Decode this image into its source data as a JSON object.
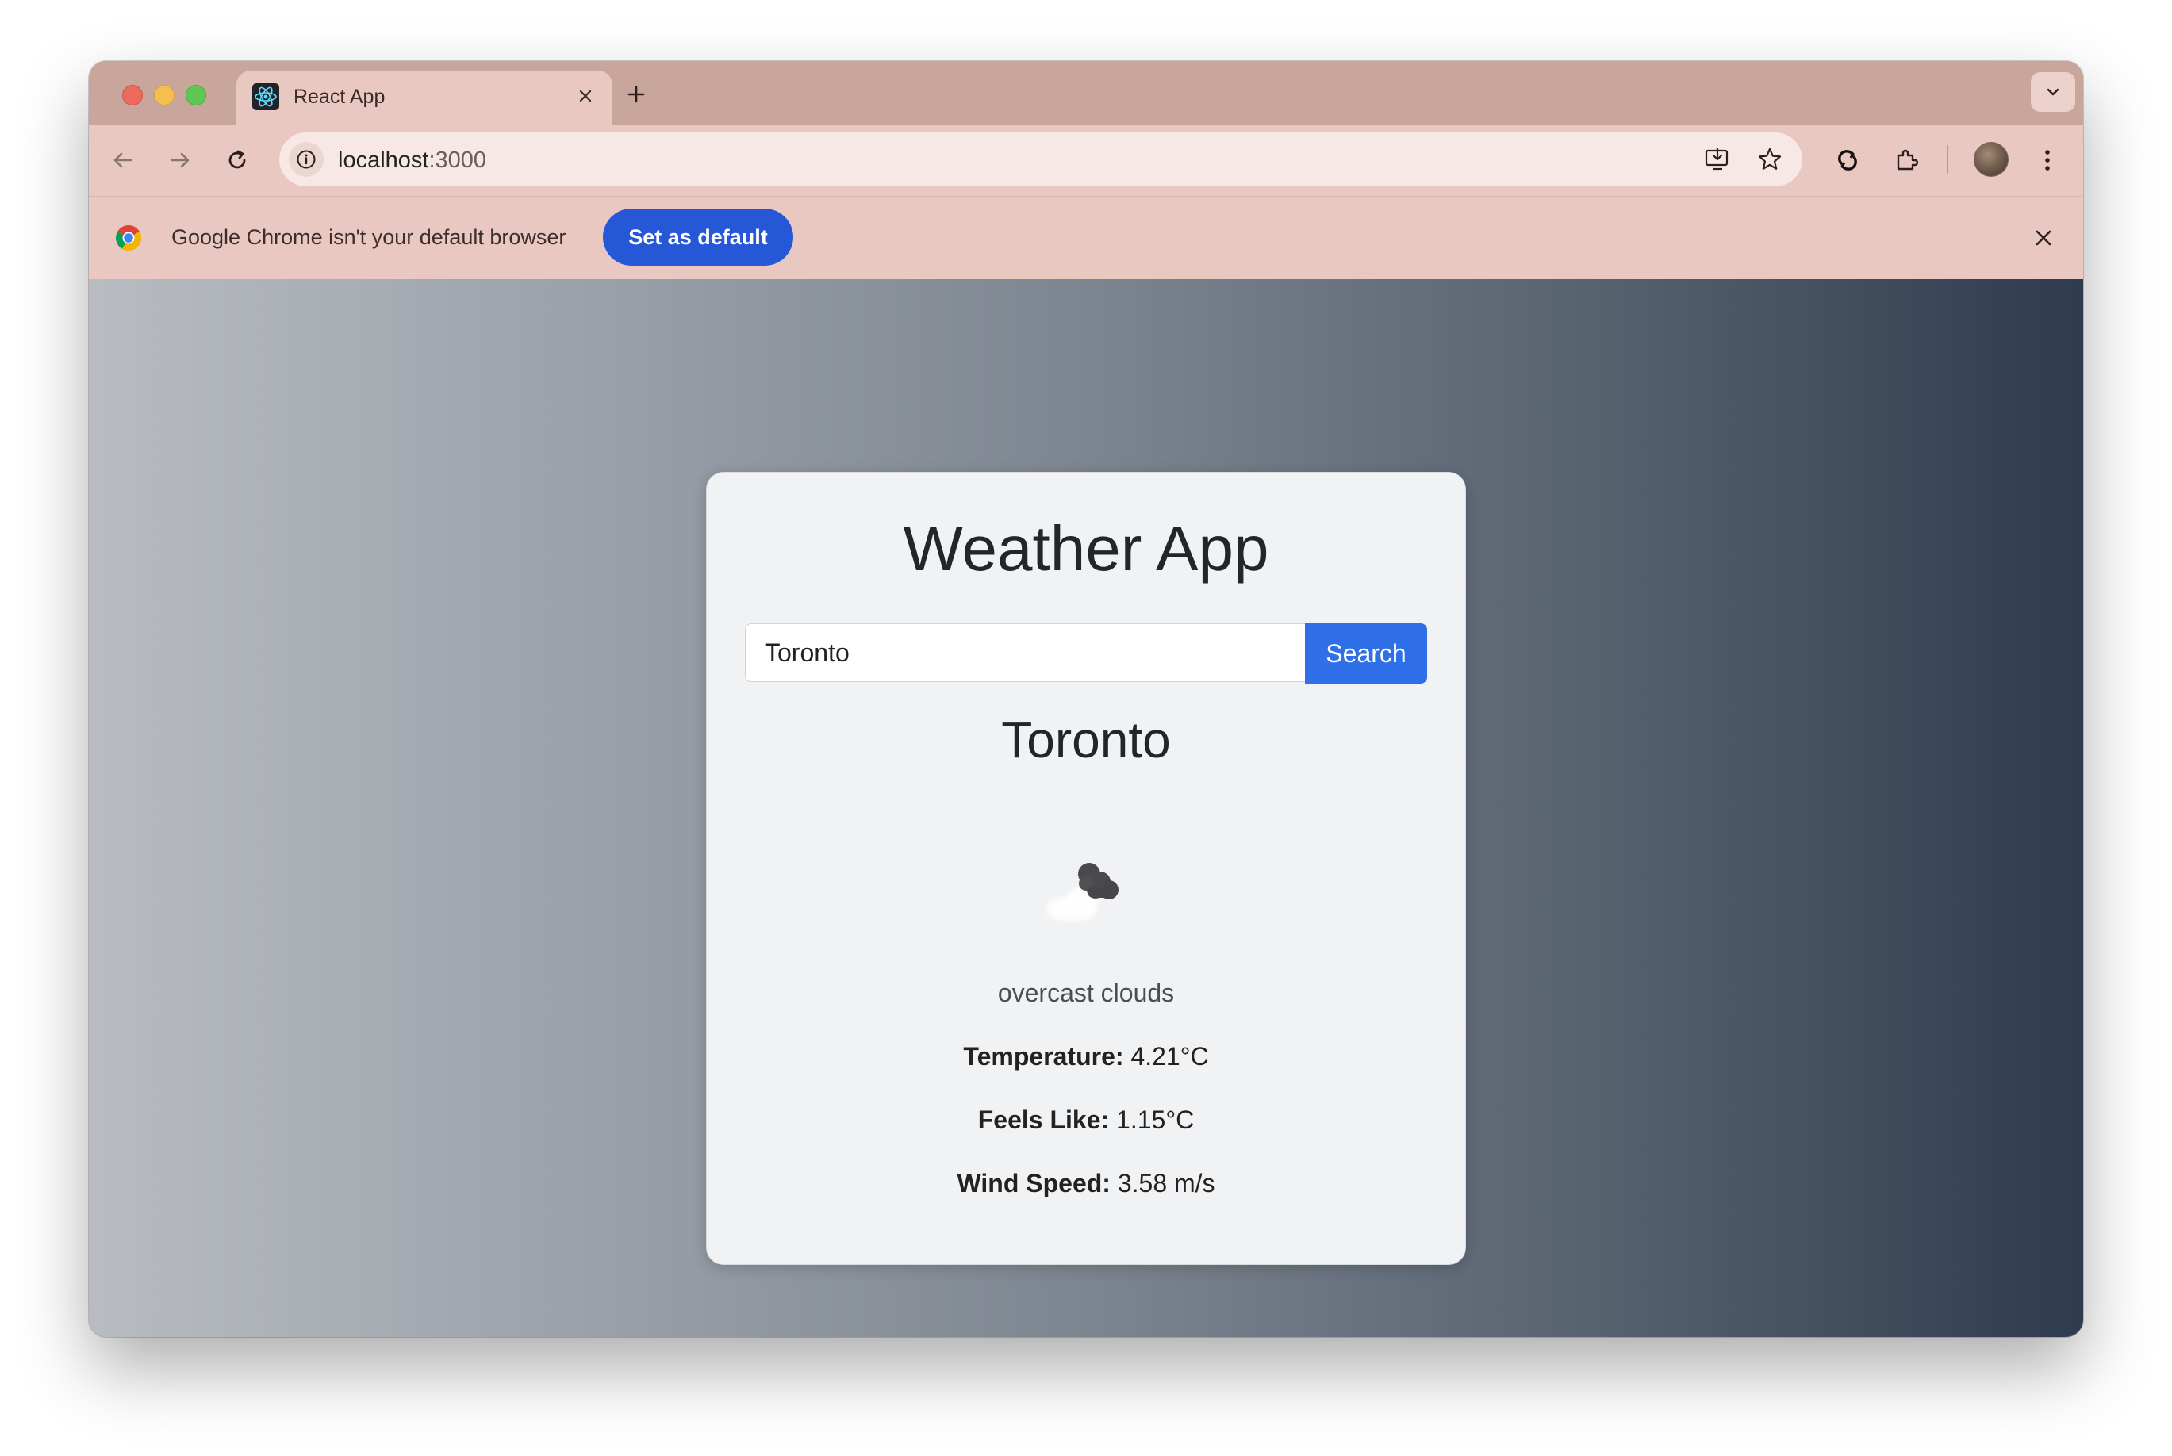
{
  "browser": {
    "tab": {
      "title": "React App",
      "icon": "react-logo-icon"
    },
    "address": {
      "host": "localhost",
      "port": ":3000"
    },
    "infobar": {
      "message": "Google Chrome isn't your default browser",
      "button_label": "Set as default"
    }
  },
  "app": {
    "title": "Weather App",
    "search": {
      "value": "Toronto",
      "button_label": "Search"
    },
    "city": "Toronto",
    "icon": "overcast-clouds-icon",
    "description": "overcast clouds",
    "stats": {
      "temperature": {
        "label": "Temperature:",
        "value": "4.21°C"
      },
      "feels_like": {
        "label": "Feels Like:",
        "value": "1.15°C"
      },
      "wind_speed": {
        "label": "Wind Speed:",
        "value": "3.58 m/s"
      }
    }
  },
  "colors": {
    "accent": "#2f6fe8",
    "infobar_button": "#2557d6",
    "chrome_frame": "#c9a69b"
  }
}
